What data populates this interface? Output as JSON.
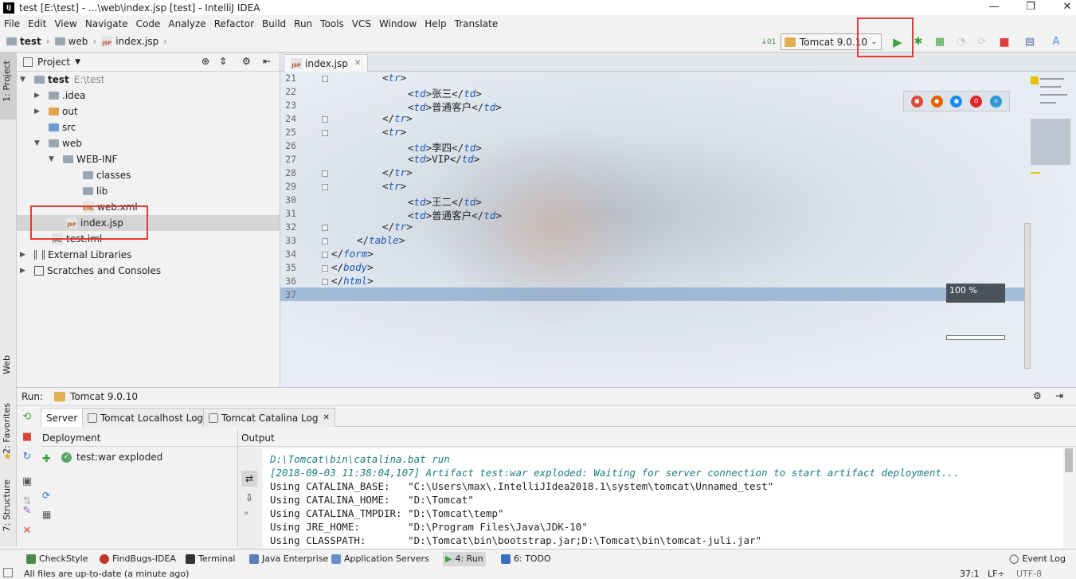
{
  "window": {
    "title": "test [E:\\test] - ...\\web\\index.jsp [test] - IntelliJ IDEA",
    "minimize": "—",
    "maximize": "❐",
    "close": "✕"
  },
  "menu": [
    "File",
    "Edit",
    "View",
    "Navigate",
    "Code",
    "Analyze",
    "Refactor",
    "Build",
    "Run",
    "Tools",
    "VCS",
    "Window",
    "Help",
    "Translate"
  ],
  "breadcrumb": {
    "project": "test",
    "folder": "web",
    "file": "index.jsp"
  },
  "toolbar": {
    "run_config": "Tomcat 9.0.10"
  },
  "left_strip": {
    "project": "1: Project",
    "web": "Web",
    "favorites": "2: Favorites",
    "structure": "7: Structure"
  },
  "project_panel": {
    "title": "Project",
    "tree": [
      {
        "label": "test",
        "path": "E:\\test"
      },
      {
        "label": ".idea"
      },
      {
        "label": "out"
      },
      {
        "label": "src"
      },
      {
        "label": "web"
      },
      {
        "label": "WEB-INF"
      },
      {
        "label": "classes"
      },
      {
        "label": "lib"
      },
      {
        "label": "web.xml"
      },
      {
        "label": "index.jsp"
      },
      {
        "label": "test.iml"
      },
      {
        "label": "External Libraries"
      },
      {
        "label": "Scratches and Consoles"
      }
    ]
  },
  "editor": {
    "tab": "index.jsp",
    "line_numbers": [
      "21",
      "22",
      "23",
      "24",
      "25",
      "26",
      "27",
      "28",
      "29",
      "30",
      "31",
      "32",
      "33",
      "34",
      "35",
      "36",
      "37"
    ],
    "cells": {
      "c22": "张三",
      "c23": "普通客户",
      "c26": "李四",
      "c27": "VIP",
      "c30": "王二",
      "c31": "普通客户"
    },
    "zoom": "100 %"
  },
  "run_panel": {
    "label": "Run:",
    "config": "Tomcat 9.0.10",
    "tabs": [
      "Server",
      "Tomcat Localhost Log",
      "Tomcat Catalina Log"
    ],
    "deployment_header": "Deployment",
    "output_header": "Output",
    "deployment_item": "test:war exploded",
    "output": [
      "D:\\Tomcat\\bin\\catalina.bat run",
      "[2018-09-03 11:38:04,107] Artifact test:war exploded: Waiting for server connection to start artifact deployment...",
      "Using CATALINA_BASE:   \"C:\\Users\\max\\.IntelliJIdea2018.1\\system\\tomcat\\Unnamed_test\"",
      "Using CATALINA_HOME:   \"D:\\Tomcat\"",
      "Using CATALINA_TMPDIR: \"D:\\Tomcat\\temp\"",
      "Using JRE_HOME:        \"D:\\Program Files\\Java\\JDK-10\"",
      "Using CLASSPATH:       \"D:\\Tomcat\\bin\\bootstrap.jar;D:\\Tomcat\\bin\\tomcat-juli.jar\""
    ]
  },
  "bottom_tabs": [
    "CheckStyle",
    "FindBugs-IDEA",
    "Terminal",
    "Java Enterprise",
    "Application Servers",
    "4: Run",
    "6: TODO"
  ],
  "event_log": "Event Log",
  "status": {
    "message": "All files are up-to-date (a minute ago)",
    "position": "37:1",
    "line_sep": "LF÷",
    "encoding": "UTF-8"
  }
}
